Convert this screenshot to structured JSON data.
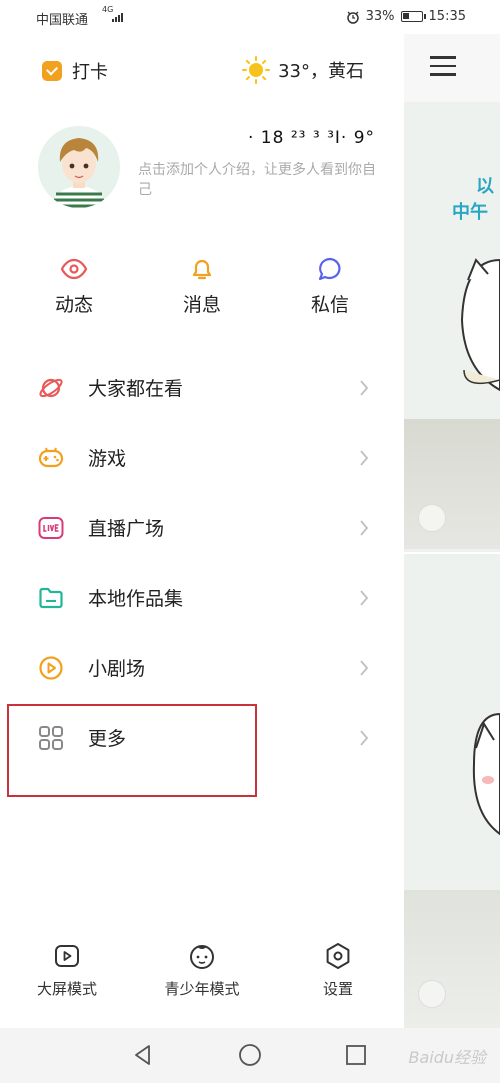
{
  "status_bar": {
    "carrier": "中国联通",
    "network": "4G",
    "battery": "33%",
    "time": "15:35"
  },
  "top_row": {
    "checkin_label": "打卡",
    "weather": "33°，黄石"
  },
  "profile": {
    "username": "· 18 ²³ ³ ³I· 9°",
    "bio": "点击添加个人介绍，让更多人看到你自己"
  },
  "quick_actions": [
    {
      "label": "动态",
      "icon": "eye-icon",
      "color": "#e85a5a"
    },
    {
      "label": "消息",
      "icon": "bell-icon",
      "color": "#f2a11f"
    },
    {
      "label": "私信",
      "icon": "chat-bubble-icon",
      "color": "#5a63e8"
    }
  ],
  "menu": [
    {
      "label": "大家都在看",
      "icon": "planet-icon",
      "color": "#e85a5a"
    },
    {
      "label": "游戏",
      "icon": "gamepad-icon",
      "color": "#f2a11f"
    },
    {
      "label": "直播广场",
      "icon": "live-icon",
      "color": "#d83a7a"
    },
    {
      "label": "本地作品集",
      "icon": "folder-icon",
      "color": "#21b59a"
    },
    {
      "label": "小剧场",
      "icon": "play-circle-icon",
      "color": "#f2a11f"
    },
    {
      "label": "更多",
      "icon": "grid-icon",
      "color": "#888888"
    }
  ],
  "bottom_tools": [
    {
      "label": "大屏模式",
      "icon": "tv-play-icon"
    },
    {
      "label": "青少年模式",
      "icon": "child-face-icon"
    },
    {
      "label": "设置",
      "icon": "settings-hex-icon"
    }
  ],
  "content_preview": {
    "heading_lines": [
      "以",
      "中午"
    ]
  },
  "navbar": {
    "watermark": "Baidu经验"
  },
  "colors": {
    "highlight_border": "#c8333b",
    "accent_orange": "#f2a11f"
  }
}
